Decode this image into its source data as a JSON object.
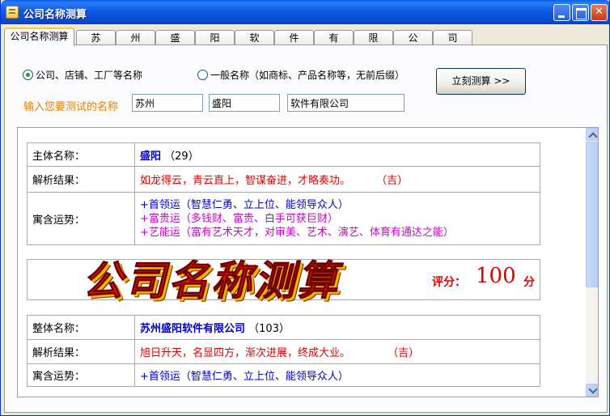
{
  "window": {
    "title": "公司名称测算"
  },
  "tabs": [
    {
      "label": "公司名称测算",
      "active": true
    },
    {
      "label": "苏"
    },
    {
      "label": "州"
    },
    {
      "label": "盛"
    },
    {
      "label": "阳"
    },
    {
      "label": "软"
    },
    {
      "label": "件"
    },
    {
      "label": "有"
    },
    {
      "label": "限"
    },
    {
      "label": "公"
    },
    {
      "label": "司"
    }
  ],
  "options": {
    "company": {
      "label": "公司、店铺、工厂等名称",
      "selected": true
    },
    "general": {
      "label": "一般名称（如商标、产品名称等，无前后缀）",
      "selected": false
    }
  },
  "calc_button": {
    "label": "立刻测算 >>"
  },
  "input": {
    "label": "输入您要测试的名称",
    "region": "苏州",
    "core": "盛阳",
    "suffix": "软件有限公司"
  },
  "main_result": {
    "name_label": "主体名称：",
    "name": "盛阳",
    "score": "（29）",
    "analysis_label": "解析结果：",
    "analysis": "如龙得云，青云直上，智谋奋进，才略奏功。",
    "analysis_tag": "（吉）",
    "fortune_label": "寓含运势：",
    "fortunes": [
      "+首领运（智慧仁勇、立上位、能领导众人）",
      "+富贵运（多钱财、富贵、白手可获巨财）",
      "+艺能运（富有艺术天才，对审美、艺术、演艺、体育有通达之能）"
    ]
  },
  "banner": {
    "logo_text": "公司名称测算",
    "score_label": "评分：",
    "score_value": "100",
    "score_unit": "分"
  },
  "full_result": {
    "name_label": "整体名称：",
    "name": "苏州盛阳软件有限公司",
    "score": "（103）",
    "analysis_label": "解析结果：",
    "analysis": "旭日升天，名显四方，渐次进展，终成大业。",
    "analysis_tag": "（吉）",
    "fortune_label": "寓含运势：",
    "fortunes": [
      "+首领运（智慧仁勇、立上位、能领导众人）"
    ]
  }
}
